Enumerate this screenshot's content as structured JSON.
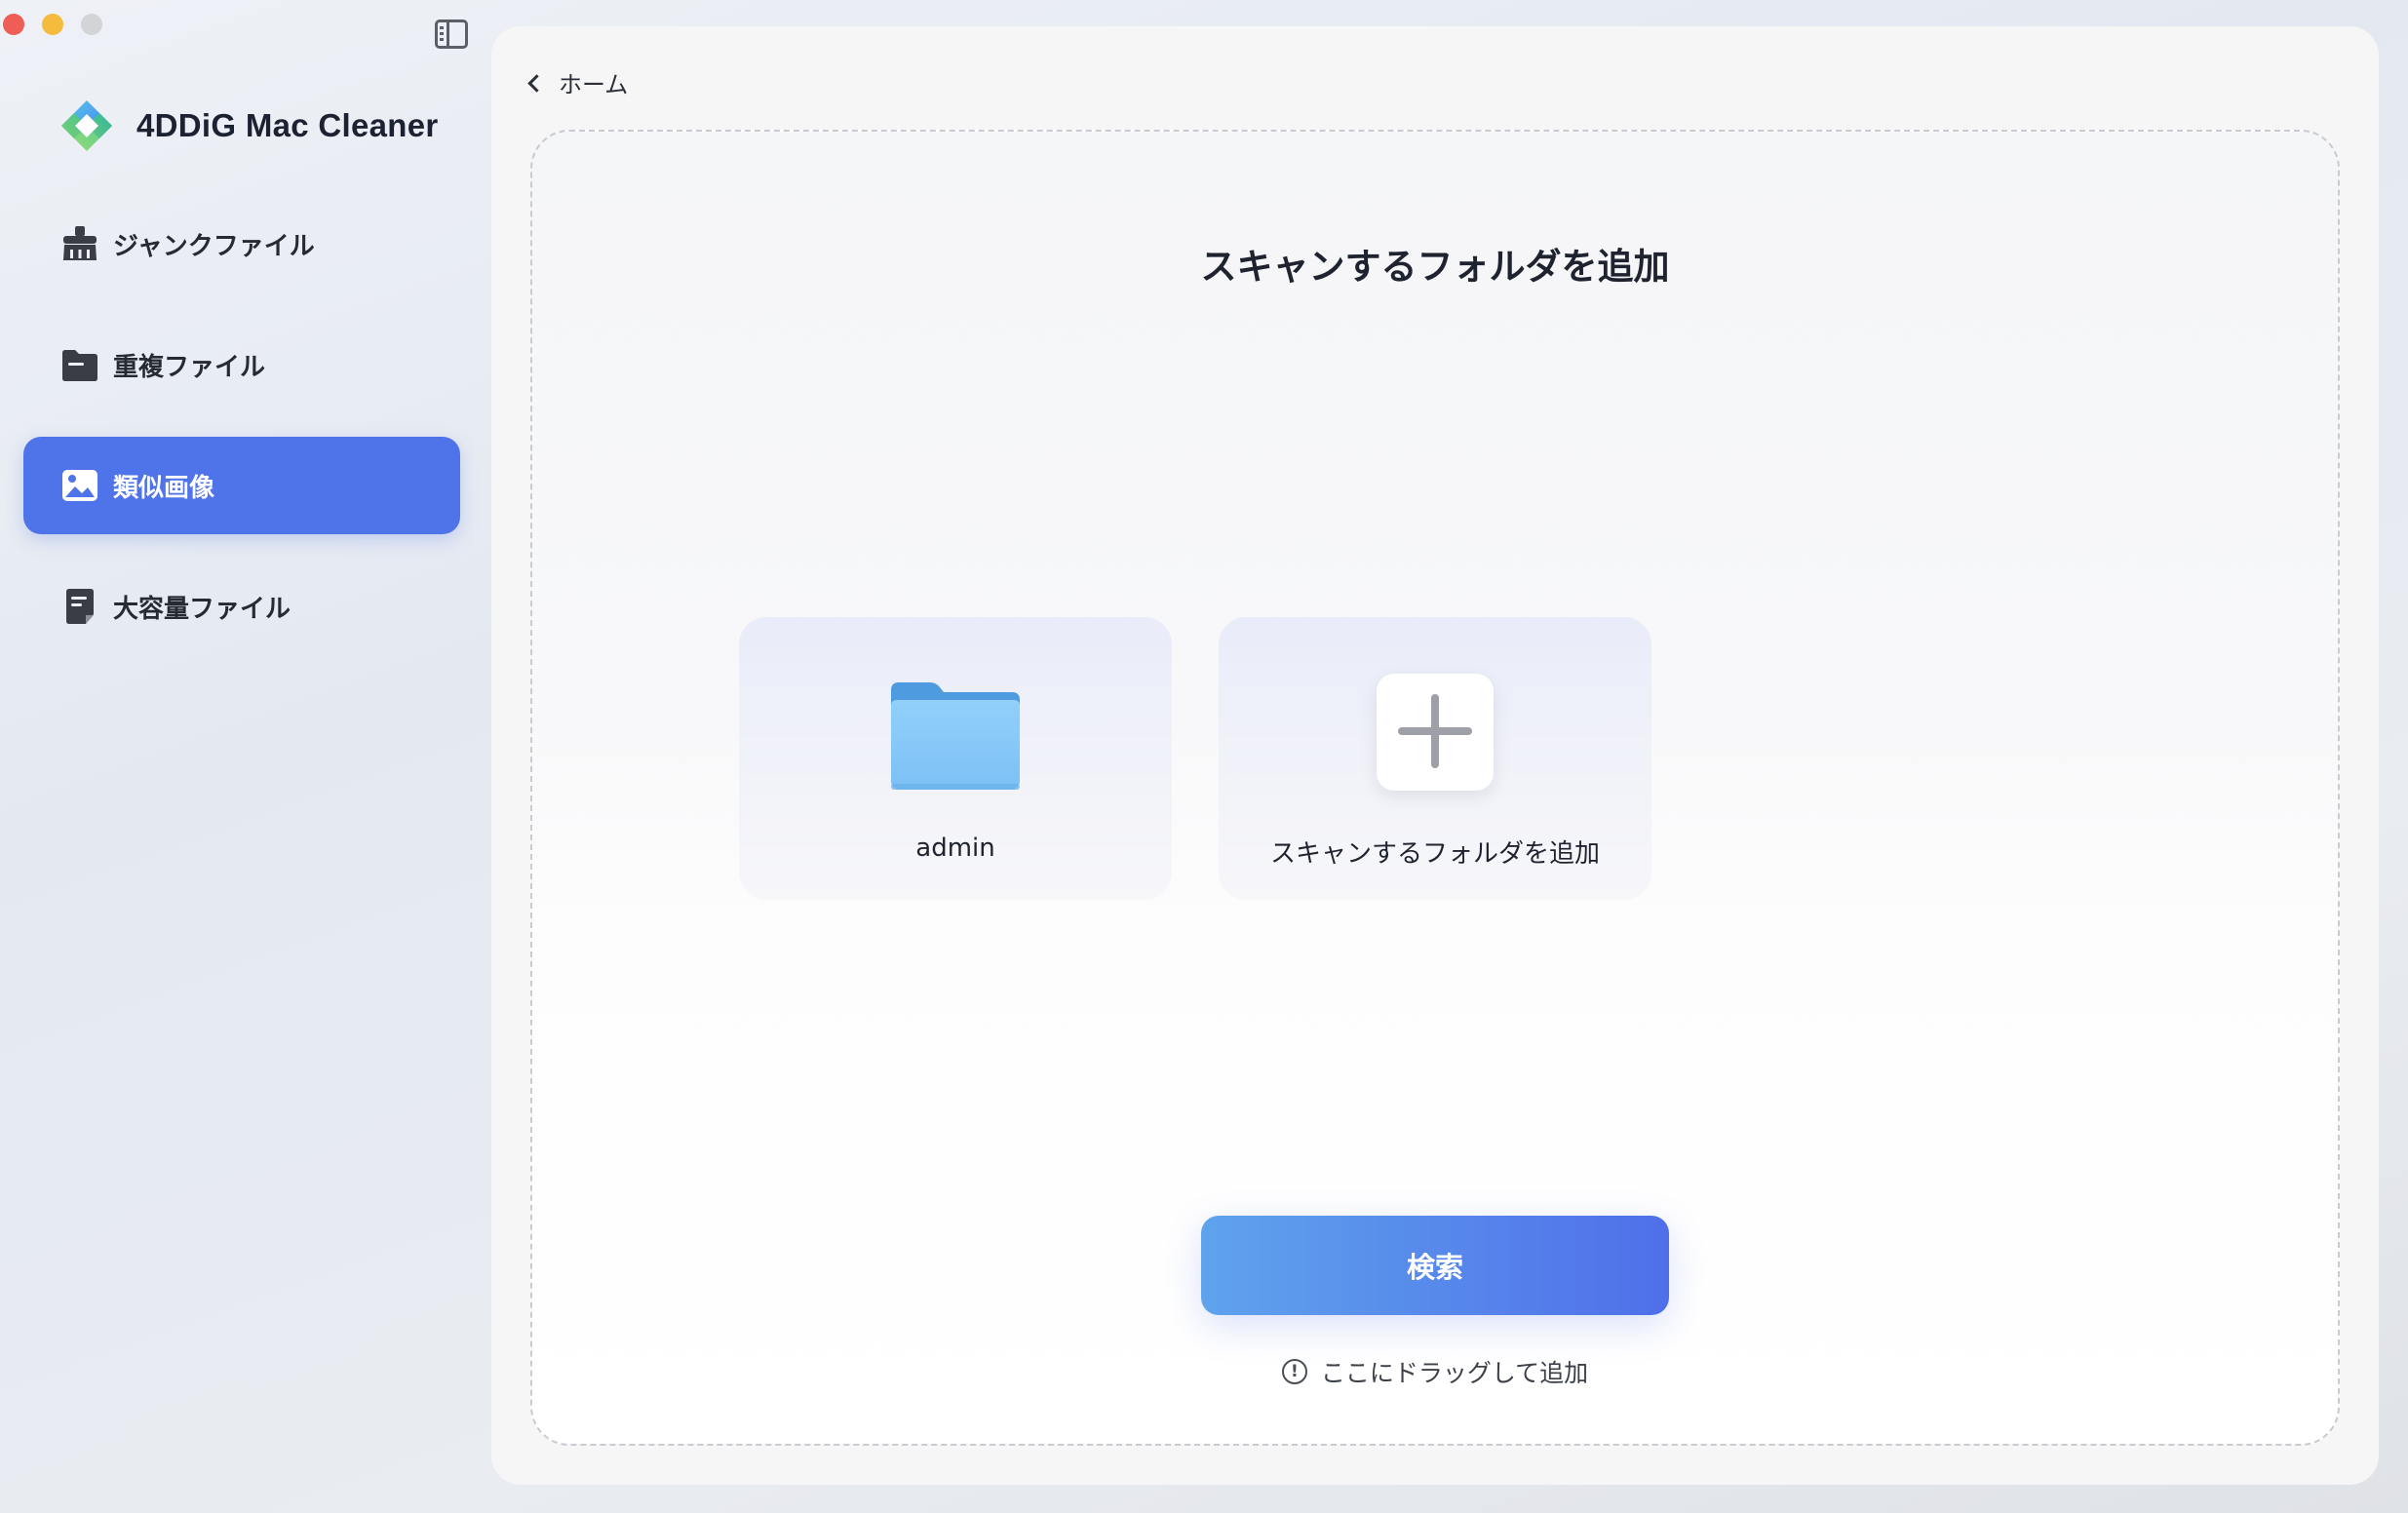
{
  "window": {
    "controls": [
      "close",
      "minimize",
      "zoom"
    ]
  },
  "app": {
    "name": "4DDiG Mac Cleaner",
    "logo_icon": "4ddig-diamond-logo"
  },
  "sidebar": {
    "items": [
      {
        "label": "ジャンクファイル",
        "icon": "broom-icon",
        "active": false
      },
      {
        "label": "重複ファイル",
        "icon": "folder-icon",
        "active": false
      },
      {
        "label": "類似画像",
        "icon": "image-icon",
        "active": true
      },
      {
        "label": "大容量ファイル",
        "icon": "document-icon",
        "active": false
      }
    ]
  },
  "main": {
    "back_label": "ホーム",
    "title": "スキャンするフォルダを追加",
    "folders": [
      {
        "label": "admin",
        "icon": "folder-icon"
      }
    ],
    "add_folder_label": "スキャンするフォルダを追加",
    "search_button": "検索",
    "drag_hint": "ここにドラッグして追加"
  },
  "colors": {
    "accent": "#4f73e9",
    "button_start": "#5fa3ec",
    "button_end": "#4f6fea",
    "close": "#ee5d56",
    "minimize": "#f4bb3d",
    "zoom": "#d3d4d6"
  }
}
